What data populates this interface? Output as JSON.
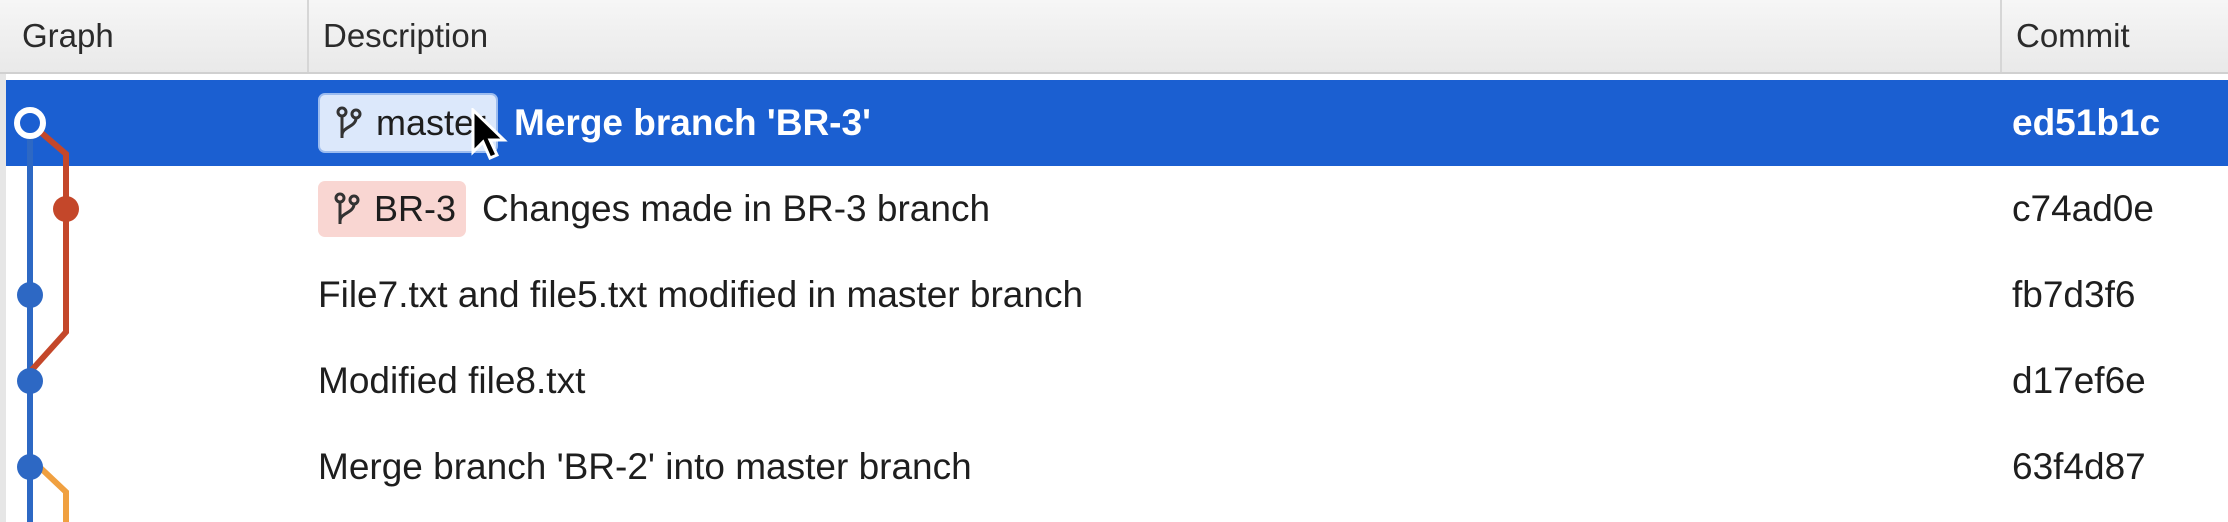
{
  "columns": {
    "graph": "Graph",
    "description": "Description",
    "commit": "Commit"
  },
  "colors": {
    "selection": "#1b5fd1",
    "master_line": "#2d68c4",
    "br3_line": "#c4472a",
    "br2_line": "#f0a040",
    "master_tag_bg": "#dce8fb",
    "br3_tag_bg": "#f9d6d2"
  },
  "rows": [
    {
      "tag": "master",
      "tag_icon": "branch-icon",
      "message": "Merge branch 'BR-3'",
      "commit": "ed51b1c",
      "selected": true
    },
    {
      "tag": "BR-3",
      "tag_icon": "branch-icon",
      "message": "Changes made in BR-3 branch",
      "commit": "c74ad0e",
      "selected": false
    },
    {
      "message": "File7.txt and file5.txt modified in master branch",
      "commit": "fb7d3f6",
      "selected": false
    },
    {
      "message": "Modified file8.txt",
      "commit": "d17ef6e",
      "selected": false
    },
    {
      "message": "Merge branch 'BR-2' into master branch",
      "commit": "63f4d87",
      "selected": false
    }
  ]
}
